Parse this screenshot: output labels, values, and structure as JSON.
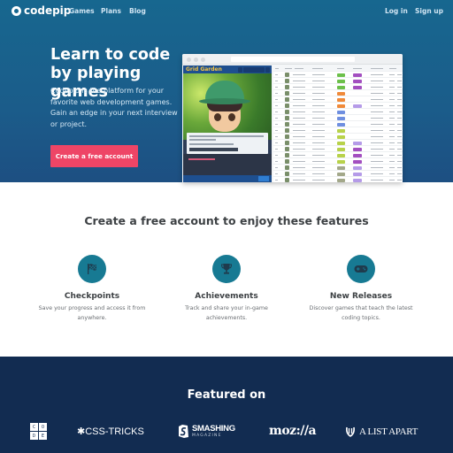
{
  "nav": {
    "brand": "codepip",
    "links": [
      "Games",
      "Plans",
      "Blog"
    ],
    "login": "Log in",
    "signup": "Sign up"
  },
  "hero": {
    "title": "Learn to code by playing games",
    "description": "Codepip is the platform for your favorite web development games. Gain an edge in your next interview or project.",
    "cta": "Create a free account",
    "preview": {
      "game_logo": "Grid Garden",
      "badge_colors": [
        "#6cc04a",
        "#a34fc0",
        "#f08a3a",
        "#6f8fe0",
        "#b8d24a",
        "#a3a88a",
        "#b59be8"
      ]
    }
  },
  "features": {
    "title": "Create a free account to enjoy these features",
    "items": [
      {
        "icon": "checkered-flag-icon",
        "title": "Checkpoints",
        "description": "Save your progress and access it from anywhere."
      },
      {
        "icon": "trophy-icon",
        "title": "Achievements",
        "description": "Track and share your in-game achievements."
      },
      {
        "icon": "gamepad-icon",
        "title": "New Releases",
        "description": "Discover games that teach the latest coding topics."
      }
    ],
    "icon_bg": "#177a93"
  },
  "featured": {
    "title": "Featured on",
    "logos": {
      "code": [
        "C",
        "O",
        "D",
        "E"
      ],
      "css_tricks": "✱CSS-TRICKS",
      "smashing": "SMASHING",
      "smashing_sub": "MAGAZINE",
      "mozilla": "moz://a",
      "alistapart": "A LIST APART"
    }
  },
  "colors": {
    "hero_bg": "#17678f",
    "cta": "#ee4566",
    "featured_bg": "#122c51"
  }
}
